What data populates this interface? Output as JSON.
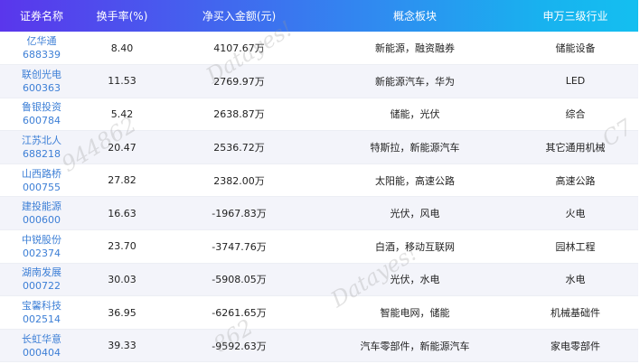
{
  "table": {
    "headers": [
      "证券名称",
      "换手率(%)",
      "净买入金额(元)",
      "概念板块",
      "申万三级行业"
    ],
    "rows": [
      {
        "name": "亿华通",
        "code": "688339",
        "turnover": "8.40",
        "net_buy": "4107.67万",
        "concept": "新能源，融资融券",
        "industry": "储能设备"
      },
      {
        "name": "联创光电",
        "code": "600363",
        "turnover": "11.53",
        "net_buy": "2769.97万",
        "concept": "新能源汽车，华为",
        "industry": "LED"
      },
      {
        "name": "鲁银投资",
        "code": "600784",
        "turnover": "5.42",
        "net_buy": "2638.87万",
        "concept": "储能，光伏",
        "industry": "综合"
      },
      {
        "name": "江苏北人",
        "code": "688218",
        "turnover": "20.47",
        "net_buy": "2536.72万",
        "concept": "特斯拉，新能源汽车",
        "industry": "其它通用机械"
      },
      {
        "name": "山西路桥",
        "code": "000755",
        "turnover": "27.82",
        "net_buy": "2382.00万",
        "concept": "太阳能，高速公路",
        "industry": "高速公路"
      },
      {
        "name": "建投能源",
        "code": "000600",
        "turnover": "16.63",
        "net_buy": "-1967.83万",
        "concept": "光伏，风电",
        "industry": "火电"
      },
      {
        "name": "中锐股份",
        "code": "002374",
        "turnover": "23.70",
        "net_buy": "-3747.76万",
        "concept": "白酒，移动互联网",
        "industry": "园林工程"
      },
      {
        "name": "湖南发展",
        "code": "000722",
        "turnover": "30.03",
        "net_buy": "-5908.05万",
        "concept": "光伏，水电",
        "industry": "水电"
      },
      {
        "name": "宝馨科技",
        "code": "002514",
        "turnover": "36.95",
        "net_buy": "-6261.65万",
        "concept": "智能电网，储能",
        "industry": "机械基础件"
      },
      {
        "name": "长虹华意",
        "code": "000404",
        "turnover": "39.33",
        "net_buy": "-9592.63万",
        "concept": "汽车零部件，新能源汽车",
        "industry": "家电零部件"
      }
    ]
  },
  "watermarks": [
    "Datayes!",
    "944862",
    "Datayes!",
    "C7",
    "862"
  ]
}
